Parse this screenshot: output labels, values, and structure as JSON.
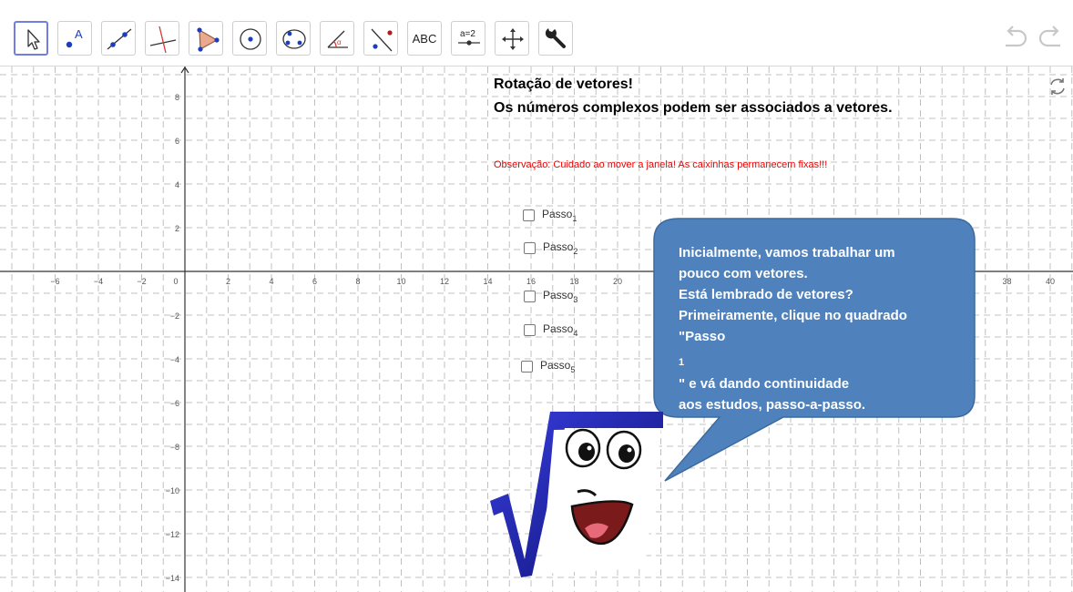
{
  "toolbar": {
    "tools": [
      {
        "name": "move-tool",
        "icon": "arrow-cursor-icon",
        "active": true
      },
      {
        "name": "point-tool",
        "icon": "point-icon",
        "label": "A"
      },
      {
        "name": "line-tool",
        "icon": "line-through-two-points-icon"
      },
      {
        "name": "perpendicular-line-tool",
        "icon": "perpendicular-line-icon"
      },
      {
        "name": "polygon-tool",
        "icon": "polygon-icon"
      },
      {
        "name": "circle-tool",
        "icon": "circle-center-point-icon"
      },
      {
        "name": "conic-tool",
        "icon": "ellipse-icon"
      },
      {
        "name": "angle-tool",
        "icon": "angle-icon",
        "label": "α"
      },
      {
        "name": "reflect-tool",
        "icon": "reflect-about-line-icon"
      },
      {
        "name": "text-tool",
        "icon": "text-icon",
        "label": "ABC"
      },
      {
        "name": "slider-tool",
        "icon": "slider-icon",
        "label": "a=2"
      },
      {
        "name": "move-graphics-tool",
        "icon": "move-graphics-view-icon"
      },
      {
        "name": "settings-tool",
        "icon": "wrench-icon"
      }
    ],
    "undo_icon": "undo-icon",
    "redo_icon": "redo-icon"
  },
  "graphics": {
    "refresh_icon": "refresh-icon",
    "x_ticks": [
      "−6",
      "−4",
      "−2",
      "0",
      "2",
      "4",
      "6",
      "8",
      "10",
      "12",
      "14",
      "16",
      "18",
      "20",
      "38",
      "40"
    ],
    "y_ticks": [
      "8",
      "6",
      "4",
      "2",
      "−2",
      "−4",
      "−6",
      "−8",
      "−10",
      "−12",
      "−14"
    ],
    "title": "Rotação de vetores!",
    "subtitle": "Os números complexos podem ser associados a vetores.",
    "observation": "Observação: Cuidado ao mover a janela! As caixinhas permanecem fixas!!!",
    "steps": [
      {
        "label": "Passo",
        "index": "1",
        "checked": false
      },
      {
        "label": "Passo",
        "index": "2",
        "checked": false
      },
      {
        "label": "Passo",
        "index": "3",
        "checked": false
      },
      {
        "label": "Passo",
        "index": "4",
        "checked": false
      },
      {
        "label": "Passo",
        "index": "5",
        "checked": false
      }
    ],
    "bubble": {
      "line1": "Inicialmente, vamos trabalhar um",
      "line2": "pouco com vetores.",
      "line3": "Está lembrado de vetores?",
      "line4": "Primeiramente, clique no quadrado",
      "line5_pre": "\"Passo",
      "line5_sub": "1",
      "line5_post": "\" e vá dando continuidade",
      "line6": "aos estudos, passo-a-passo."
    },
    "mascot_icon": "square-root-mascot-icon"
  },
  "colors": {
    "accent": "#6f7ee0",
    "bubble": "#4f81bd",
    "observation": "#ee0000",
    "grid": "#c0c0c0"
  }
}
